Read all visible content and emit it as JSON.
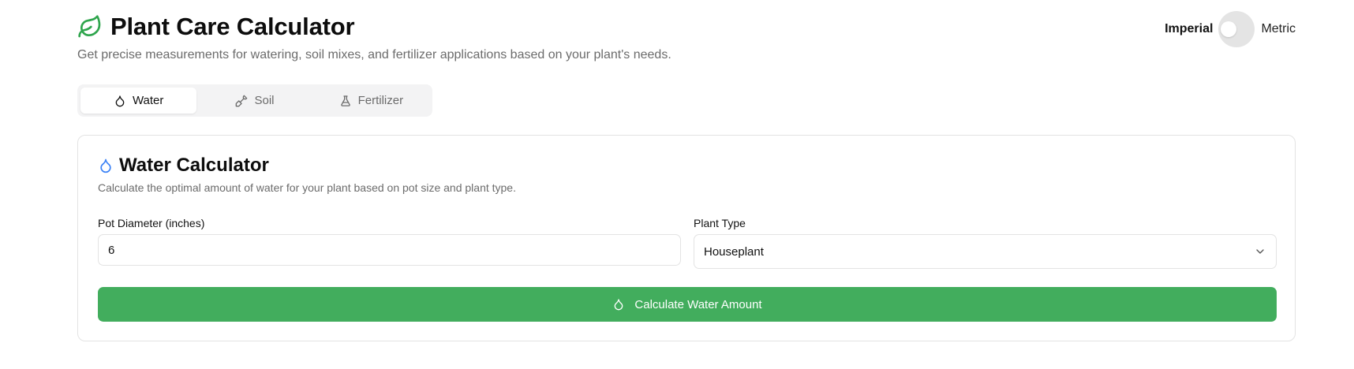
{
  "header": {
    "title": "Plant Care Calculator",
    "subtitle": "Get precise measurements for watering, soil mixes, and fertilizer applications based on your plant's needs.",
    "brand_color": "#2fa54d"
  },
  "unit_toggle": {
    "left_label": "Imperial",
    "right_label": "Metric",
    "selected": "Imperial"
  },
  "tabs": [
    {
      "label": "Water",
      "icon": "droplet-icon",
      "active": true
    },
    {
      "label": "Soil",
      "icon": "shovel-icon",
      "active": false
    },
    {
      "label": "Fertilizer",
      "icon": "flask-icon",
      "active": false
    }
  ],
  "card": {
    "title": "Water Calculator",
    "icon": "droplet-icon",
    "icon_color": "#3b82f6",
    "description": "Calculate the optimal amount of water for your plant based on pot size and plant type.",
    "pot_diameter": {
      "label": "Pot Diameter (inches)",
      "value": "6"
    },
    "plant_type": {
      "label": "Plant Type",
      "value": "Houseplant"
    },
    "button": {
      "label": "Calculate Water Amount",
      "color": "#42ad5d"
    }
  }
}
